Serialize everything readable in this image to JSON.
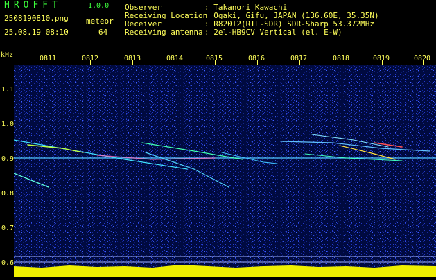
{
  "app": {
    "title": "HROFFT",
    "version": "1.0.0"
  },
  "file": {
    "name": "2508190810.png",
    "timestamp": "25.08.19 08:10"
  },
  "meteor": {
    "label": "meteor",
    "count": "64"
  },
  "info": [
    {
      "label": "Observer",
      "value": ": Takanori Kawachi"
    },
    {
      "label": "Receiving Location",
      "value": ": Ogaki, Gifu, JAPAN (136.60E, 35.35N)"
    },
    {
      "label": "Receiver",
      "value": ": R820T2(RTL-SDR) SDR-Sharp 53.372MHz"
    },
    {
      "label": "Receiving antenna",
      "value": ": 2el-HB9CV Vertical (el. E-W)"
    }
  ],
  "axes": {
    "y_unit": "kHz",
    "y_ticks": [
      "1.1",
      "1.0",
      "0.9",
      "0.8",
      "0.7",
      "0.6"
    ],
    "x_ticks": [
      "0811",
      "0812",
      "0813",
      "0814",
      "0815",
      "0816",
      "0817",
      "0818",
      "0819",
      "0820"
    ]
  },
  "colors": {
    "text_green": "#3cff3c",
    "text_yellow": "#ffff5a",
    "background": "#000000",
    "noise_floor": "#000a40"
  }
}
